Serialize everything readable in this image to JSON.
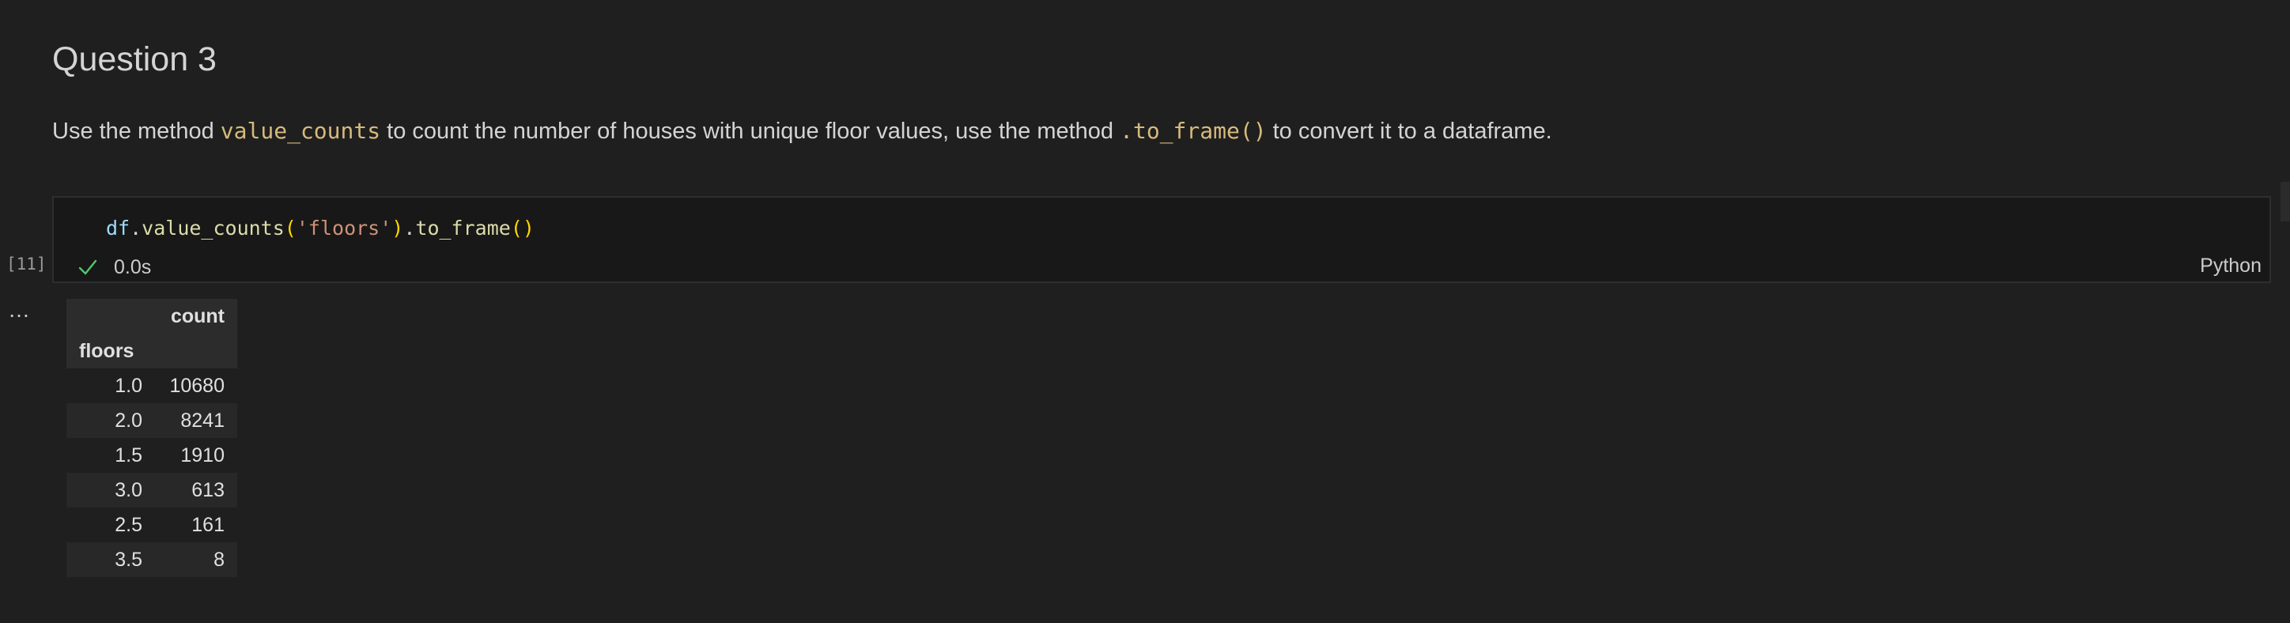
{
  "markdown": {
    "heading": "Question 3",
    "paragraph": {
      "part1": "Use the method ",
      "code1": "value_counts",
      "part2": " to count the number of houses with unique floor values, use the method ",
      "code2": ".to_frame()",
      "part3": " to convert it to a dataframe."
    }
  },
  "code_cell": {
    "execution_count": "[11]",
    "tokens": {
      "var": "df",
      "dot1": ".",
      "fn1": "value_counts",
      "open1": "(",
      "arg": "'floors'",
      "close1": ")",
      "dot2": ".",
      "fn2": "to_frame",
      "open2": "(",
      "close2": ")"
    },
    "status": {
      "icon": "check-icon",
      "duration": "0.0s"
    },
    "language": "Python"
  },
  "output": {
    "menu_label": "…",
    "table": {
      "column_header": "count",
      "index_name": "floors",
      "rows": [
        {
          "index": "1.0",
          "count": "10680"
        },
        {
          "index": "2.0",
          "count": "8241"
        },
        {
          "index": "1.5",
          "count": "1910"
        },
        {
          "index": "3.0",
          "count": "613"
        },
        {
          "index": "2.5",
          "count": "161"
        },
        {
          "index": "3.5",
          "count": "8"
        }
      ]
    }
  },
  "colors": {
    "background": "#1f1f1f",
    "cell_background": "#181818",
    "inline_code": "#d7ba7d",
    "success": "#4ec96c"
  }
}
